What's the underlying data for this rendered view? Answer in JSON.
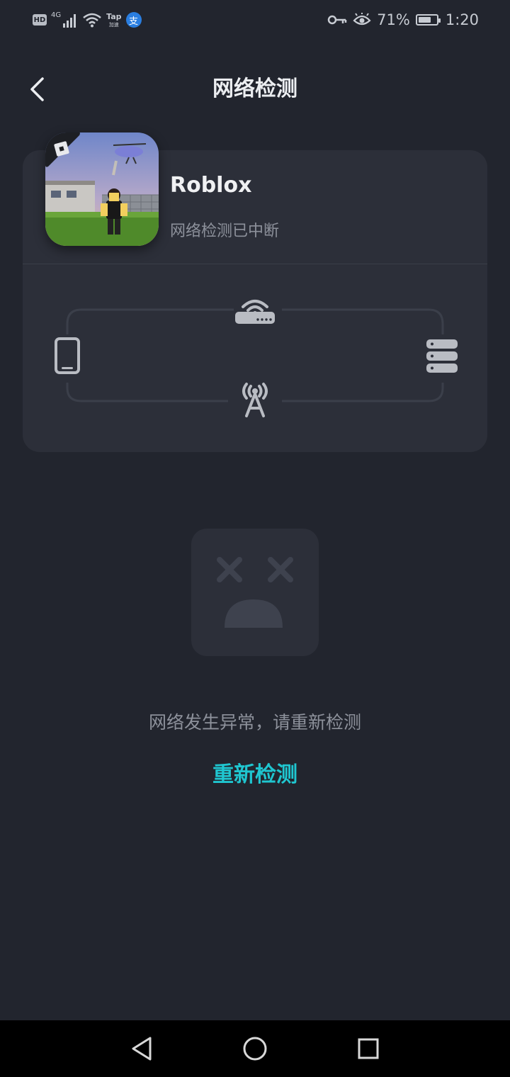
{
  "status_bar": {
    "hd": "HD",
    "network_type": "4G",
    "tap_label": "Tap",
    "tap_sub": "加速",
    "pay_glyph": "支",
    "battery_percent": "71%",
    "battery_level": 0.71,
    "time": "1:20",
    "icons": [
      "hd-icon",
      "signal-icon",
      "wifi-icon",
      "tap-accelerator-icon",
      "alipay-icon",
      "key-icon",
      "eye-icon",
      "battery-icon"
    ]
  },
  "header": {
    "title": "网络检测",
    "back_icon": "back-arrow-icon"
  },
  "app": {
    "name": "Roblox",
    "status": "网络检测已中断"
  },
  "diagram": {
    "nodes": [
      "phone-icon",
      "router-icon",
      "cell-tower-icon",
      "server-icon"
    ]
  },
  "error": {
    "message": "网络发生异常，请重新检测",
    "retry_label": "重新检测",
    "icon": "sad-face-icon"
  },
  "colors": {
    "background": "#22252e",
    "card": "#2c2f39",
    "accent": "#1fc6d0",
    "muted_text": "#8d919b",
    "icon_gray": "#b9bcc3"
  },
  "nav_bar": {
    "icons": [
      "nav-back-icon",
      "nav-home-icon",
      "nav-recents-icon"
    ]
  }
}
